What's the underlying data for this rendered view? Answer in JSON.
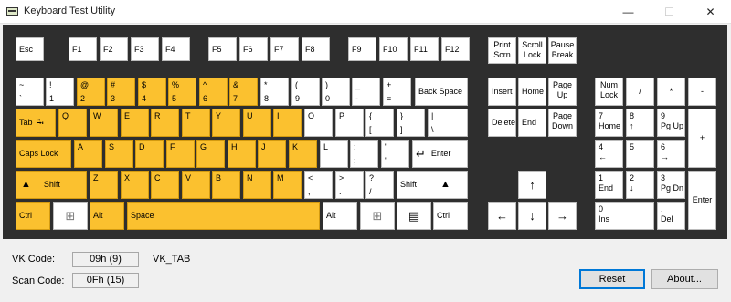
{
  "window": {
    "title": "Keyboard Test Utility",
    "min_glyph": "—",
    "max_glyph": "☐",
    "close_glyph": "✕"
  },
  "keys": {
    "esc": "Esc",
    "f1": "F1",
    "f2": "F2",
    "f3": "F3",
    "f4": "F4",
    "f5": "F5",
    "f6": "F6",
    "f7": "F7",
    "f8": "F8",
    "f9": "F9",
    "f10": "F10",
    "f11": "F11",
    "f12": "F12",
    "prtsc": [
      "Print",
      "Scrn"
    ],
    "scrlk": [
      "Scroll",
      "Lock"
    ],
    "pause": [
      "Pause",
      "Break"
    ],
    "grave": [
      "~",
      "`"
    ],
    "d1": [
      "!",
      "1"
    ],
    "d2": [
      "@",
      "2"
    ],
    "d3": [
      "#",
      "3"
    ],
    "d4": [
      "$",
      "4"
    ],
    "d5": [
      "%",
      "5"
    ],
    "d6": [
      "^",
      "6"
    ],
    "d7": [
      "&",
      "7"
    ],
    "d8": [
      "*",
      "8"
    ],
    "d9": [
      "(",
      "9"
    ],
    "d0": [
      ")",
      "0"
    ],
    "minus": [
      "_",
      "-"
    ],
    "equals": [
      "+",
      "="
    ],
    "backspace": "Back Space",
    "tab": "Tab",
    "tab_glyph": "⭾",
    "q": "Q",
    "w": "W",
    "e": "E",
    "r": "R",
    "t": "T",
    "y": "Y",
    "u": "U",
    "i": "I",
    "o": "O",
    "p": "P",
    "lbracket": [
      "{",
      "["
    ],
    "rbracket": [
      "}",
      "]"
    ],
    "backslash": [
      "|",
      "\\"
    ],
    "caps": "Caps Lock",
    "a": "A",
    "s": "S",
    "d": "D",
    "f": "F",
    "g": "G",
    "h": "H",
    "j": "J",
    "k": "K",
    "l": "L",
    "semicolon": [
      ":",
      ";"
    ],
    "quote": [
      "\"",
      "'"
    ],
    "enter": "Enter",
    "enter_glyph": "↵",
    "shift": "Shift",
    "shift_glyph": "▲",
    "z": "Z",
    "x": "X",
    "c": "C",
    "v": "V",
    "b": "B",
    "n": "N",
    "m": "M",
    "comma": [
      "<",
      ","
    ],
    "period": [
      ">",
      "."
    ],
    "slash": [
      "?",
      "/"
    ],
    "ctrl": "Ctrl",
    "alt": "Alt",
    "space": "Space",
    "win_glyph": "⊞",
    "menu_glyph": "▤",
    "ins": "Insert",
    "home": "Home",
    "pgup": [
      "Page",
      "Up"
    ],
    "del": "Delete",
    "end": "End",
    "pgdn": [
      "Page",
      "Down"
    ],
    "up": "↑",
    "down": "↓",
    "left": "←",
    "right": "→",
    "numlock": [
      "Num",
      "Lock"
    ],
    "npdiv": "/",
    "npmul": "*",
    "npsub": "-",
    "npadd": "+",
    "np7": [
      "7",
      "Home"
    ],
    "np8": [
      "8",
      "↑"
    ],
    "np9": [
      "9",
      "Pg Up"
    ],
    "np4": [
      "4",
      "←"
    ],
    "np5": "5",
    "np6": [
      "6",
      "→"
    ],
    "np1": [
      "1",
      "End"
    ],
    "np2": [
      "2",
      "↓"
    ],
    "np3": [
      "3",
      "Pg Dn"
    ],
    "np0": [
      "0",
      "Ins"
    ],
    "npdot": [
      ".",
      "Del"
    ],
    "npenter": "Enter"
  },
  "status": {
    "vk_label": "VK Code:",
    "vk_value": "09h (9)",
    "vk_name": "VK_TAB",
    "scan_label": "Scan Code:",
    "scan_value": "0Fh (15)"
  },
  "buttons": {
    "reset": "Reset",
    "about": "About..."
  },
  "colors": {
    "highlight": "#fbc12f",
    "board": "#2e2e2e",
    "key": "#ffffff",
    "default_button_border": "#0078d7"
  }
}
